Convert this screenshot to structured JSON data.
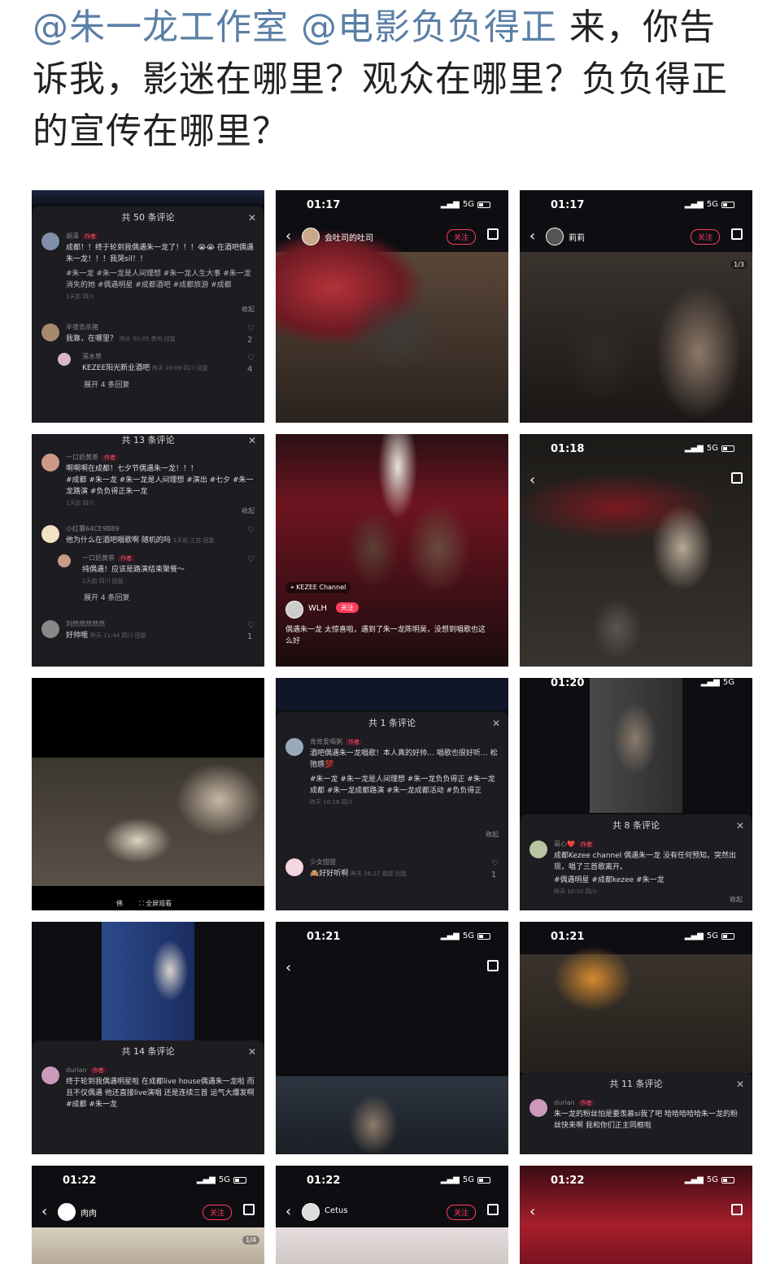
{
  "post": {
    "mention1": "@朱一龙工作室",
    "mention2": "@电影负负得正",
    "text": " 来，你告诉我，影迷在哪里？观众在哪里？负负得正的宣传在哪里？"
  },
  "colors": {
    "mention": "#5b7fa6",
    "follow": "#ff3b5c",
    "dark_bg": "#0e0e12",
    "sheet_bg": "#1c1c21"
  },
  "tiles": {
    "t1": {
      "count": "共 50 条评论",
      "c1_user": "胡溪",
      "c1_tag": "作者",
      "c1_text": "成都！！终于轮到我偶遇朱一龙了！！！😭😭 在酒吧偶遇朱一龙！！！我哭sil！！",
      "c1_tags": "#朱一龙 #朱一龙是人间理想 #朱一龙人生大事 #朱一龙消失的她 #偶遇明星 #成都酒吧 #成都旅游 #成都",
      "c1_meta": "1天前 四川",
      "c1_fold": "收起",
      "c2_user": "半夜去杀猪",
      "c2_text": "我靠，在哪里？",
      "c2_meta": "昨天 00:05 贵州 回复",
      "c2_likes": "2",
      "c3_user": "溪水草",
      "c3_text": "KEZEE阳光新业酒吧",
      "c3_meta": "昨天 00:09 四川 回复",
      "c3_likes": "4",
      "expand": "展开 4 条回复"
    },
    "t2": {
      "time": "01:17",
      "net": "5G",
      "name": "会吐司的吐司",
      "follow": "关注"
    },
    "t3": {
      "time": "01:17",
      "net": "5G",
      "name": "莉莉",
      "follow": "关注",
      "page": "1/3"
    },
    "t4": {
      "count": "共 13 条评论",
      "c1_user": "一口奶黄茶",
      "c1_tag": "作者",
      "c1_text": "啊啊啊在成都！七夕节偶遇朱一龙！！！",
      "c1_tags": "#成都 #朱一龙 #朱一龙是人间理想 #演出 #七夕 #朱一龙路演 #负负得正朱一龙",
      "c1_meta": "1天前 四川",
      "c1_fold": "收起",
      "c2_user": "小红薯64CE9B89",
      "c2_text": "他为什么在酒吧唱歌啊 随机的吗",
      "c2_meta": "1天前 江苏 回复",
      "c3_user": "一口奶黄茶",
      "c3_tag": "作者",
      "c3_text": "纯偶遇！应该是路演结束聚餐～",
      "c3_meta": "1天前 四川 回复",
      "expand": "展开 4 条回复",
      "c4_user": "刘然然然然然",
      "c4_text": "好帅哦",
      "c4_meta": "昨天 11:44 四川 回复",
      "c4_likes": "1"
    },
    "t5": {
      "loc": "KEZEE Channel",
      "user": "WLH",
      "follow": "关注",
      "caption": "偶遇朱一龙 太惊喜啦，遇到了朱一龙陈明昊，没想到唱歌也这么好"
    },
    "t6": {
      "time": "01:18",
      "net": "5G"
    },
    "t7": {
      "btn1": "佛",
      "btn2": "全屏观看"
    },
    "t8": {
      "count": "共 1 条评论",
      "c1_user": "肯肯爱喝粥",
      "c1_tag": "作者",
      "c1_text": "酒吧偶遇朱一龙唱歌！本人真的好帅… 唱歌也很好听… 松弛感💯",
      "c1_tags": "#朱一龙 #朱一龙是人间理想 #朱一龙负负得正 #朱一龙成都 #朱一龙成都路演 #朱一龙成都活动 #负负得正",
      "c1_meta": "昨天 16:16 四川",
      "c1_fold": "收起",
      "c2_user": "少女甜甜",
      "c2_text": "🙈好好听啊",
      "c2_meta": "昨天 16:27 福建 回复",
      "c2_likes": "1"
    },
    "t9": {
      "time": "01:20",
      "net": "5G",
      "count": "共 8 条评论",
      "c1_user": "哥心❤️",
      "c1_tag": "作者",
      "c1_text": "成都Kezee channel 偶遇朱一龙 没有任何预知。突然出现，唱了三首歌离开。",
      "c1_tags": "#偶遇明星 #成都kezee #朱一龙",
      "c1_meta": "昨天 10:10 四川",
      "c1_fold": "收起"
    },
    "t10": {
      "count": "共 14 条评论",
      "c1_user": "durian",
      "c1_tag": "作者",
      "c1_text": "终于轮到我偶遇明星啦 在成都live house偶遇朱一龙啦 而且不仅偶遇 他还直接live演唱 还是连续三首 运气大爆发啊#成都 #朱一龙"
    },
    "t11": {
      "time": "01:21",
      "net": "5G"
    },
    "t12": {
      "time": "01:21",
      "net": "5G",
      "count": "共 11 条评论",
      "c1_user": "durian",
      "c1_tag": "作者",
      "c1_text": "朱一龙的粉丝怕是要羡慕si我了吧 哈哈哈哈哈朱一龙的粉丝快来啊 我和你们正主同框啦"
    },
    "t13": {
      "time": "01:22",
      "net": "5G",
      "name": "肉肉",
      "follow": "关注",
      "page": "1/4"
    },
    "t14": {
      "time": "01:22",
      "net": "5G",
      "name": "Cetus",
      "follow": "关注"
    },
    "t15": {
      "time": "01:22",
      "net": "5G"
    }
  }
}
